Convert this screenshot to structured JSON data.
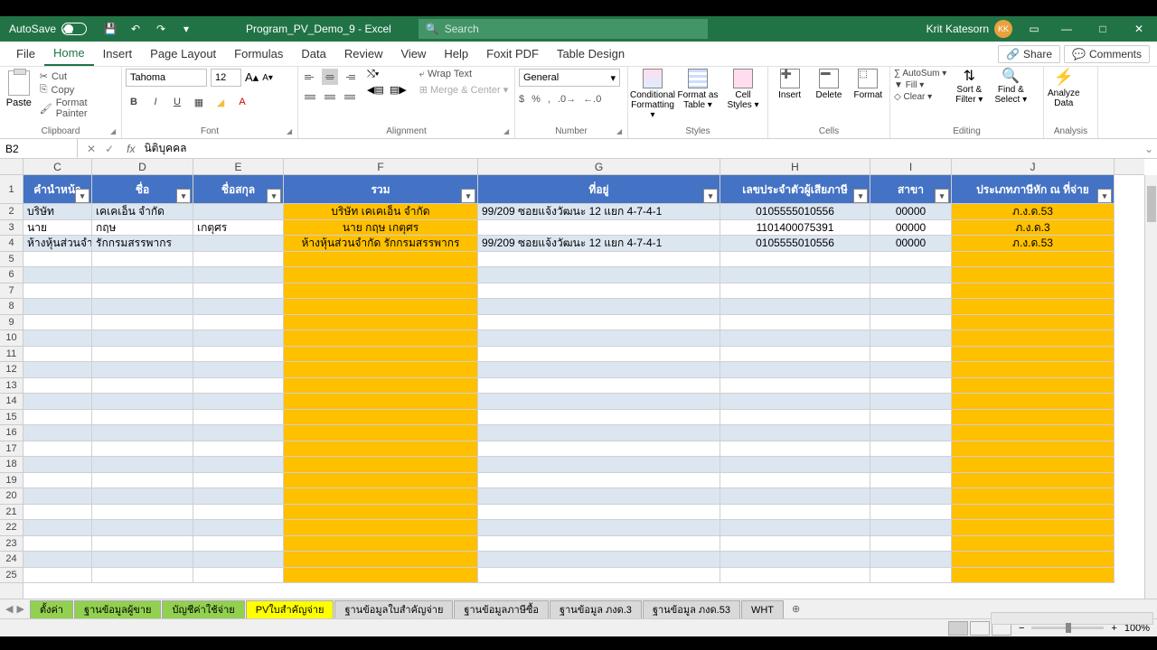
{
  "titlebar": {
    "autosave": "AutoSave",
    "autosave_state": "Off",
    "doc_title": "Program_PV_Demo_9 - Excel",
    "search_placeholder": "Search",
    "user_name": "Krit Katesorn",
    "user_initials": "KK"
  },
  "menu": {
    "items": [
      "File",
      "Home",
      "Insert",
      "Page Layout",
      "Formulas",
      "Data",
      "Review",
      "View",
      "Help",
      "Foxit PDF",
      "Table Design"
    ],
    "active_index": 1,
    "share": "Share",
    "comments": "Comments"
  },
  "ribbon": {
    "clipboard": {
      "label": "Clipboard",
      "paste": "Paste",
      "cut": "Cut",
      "copy": "Copy",
      "painter": "Format Painter"
    },
    "font": {
      "label": "Font",
      "name": "Tahoma",
      "size": "12"
    },
    "alignment": {
      "label": "Alignment",
      "wrap": "Wrap Text",
      "merge": "Merge & Center"
    },
    "number": {
      "label": "Number",
      "format": "General"
    },
    "styles": {
      "label": "Styles",
      "cond": "Conditional\nFormatting",
      "table": "Format as\nTable",
      "cell": "Cell\nStyles"
    },
    "cells": {
      "label": "Cells",
      "insert": "Insert",
      "delete": "Delete",
      "format": "Format"
    },
    "editing": {
      "label": "Editing",
      "autosum": "AutoSum",
      "fill": "Fill",
      "clear": "Clear",
      "sort": "Sort &\nFilter",
      "find": "Find &\nSelect"
    },
    "analysis": {
      "label": "Analysis",
      "analyze": "Analyze\nData"
    }
  },
  "formula_bar": {
    "ref": "B2",
    "value": "นิติบุคคล"
  },
  "columns": [
    "C",
    "D",
    "E",
    "F",
    "G",
    "H",
    "I",
    "J"
  ],
  "col_widths": [
    "cC",
    "cD",
    "cE",
    "cF",
    "cG",
    "cH",
    "cI",
    "cJ"
  ],
  "headers": [
    "คำนำหน้า",
    "ชื่อ",
    "ชื่อสกุล",
    "รวม",
    "ที่อยู่",
    "เลขประจำตัวผู้เสียภาษี",
    "สาขา",
    "ประเภทภาษีหัก ณ ที่จ่าย"
  ],
  "rows": [
    {
      "n": 2,
      "C": "บริษัท",
      "D": "เคเคเอ็น จำกัด",
      "E": "",
      "F": "บริษัท เคเคเอ็น จำกัด",
      "G": "99/209 ซอยแจ้งวัฒนะ 12 แยก 4-7-4-1",
      "H": "0105555010556",
      "I": "00000",
      "J": "ภ.ง.ด.53"
    },
    {
      "n": 3,
      "C": "นาย",
      "D": "กฤษ",
      "E": "เกตุศร",
      "F": "นาย กฤษ เกตุศร",
      "G": "",
      "H": "1101400075391",
      "I": "00000",
      "J": "ภ.ง.ด.3"
    },
    {
      "n": 4,
      "C": "ห้างหุ้นส่วนจำกัด",
      "D": "รักกรมสรรพากร",
      "E": "",
      "F": "ห้างหุ้นส่วนจำกัด รักกรมสรรพากร",
      "G": "99/209 ซอยแจ้งวัฒนะ 12 แยก 4-7-4-1",
      "H": "0105555010556",
      "I": "00000",
      "J": "ภ.ง.ด.53"
    }
  ],
  "empty_rows": [
    5,
    6,
    7,
    8,
    9,
    10,
    11,
    12,
    13,
    14,
    15,
    16,
    17,
    18,
    19,
    20,
    21,
    22,
    23,
    24,
    25
  ],
  "sheets": [
    {
      "name": "ตั้งค่า",
      "cls": "st-green"
    },
    {
      "name": "ฐานข้อมูลผู้ขาย",
      "cls": "st-green"
    },
    {
      "name": "บัญชีค่าใช้จ่าย",
      "cls": "st-green"
    },
    {
      "name": "PVใบสำคัญจ่าย",
      "cls": "st-yellow"
    },
    {
      "name": "ฐานข้อมูลใบสำคัญจ่าย",
      "cls": "st-gray"
    },
    {
      "name": "ฐานข้อมูลภาษีซื้อ",
      "cls": "st-gray"
    },
    {
      "name": "ฐานข้อมูล ภงด.3",
      "cls": "st-gray"
    },
    {
      "name": "ฐานข้อมูล ภงด.53",
      "cls": "st-gray"
    },
    {
      "name": "WHT",
      "cls": "st-gray"
    }
  ],
  "status": {
    "zoom": "100%"
  }
}
